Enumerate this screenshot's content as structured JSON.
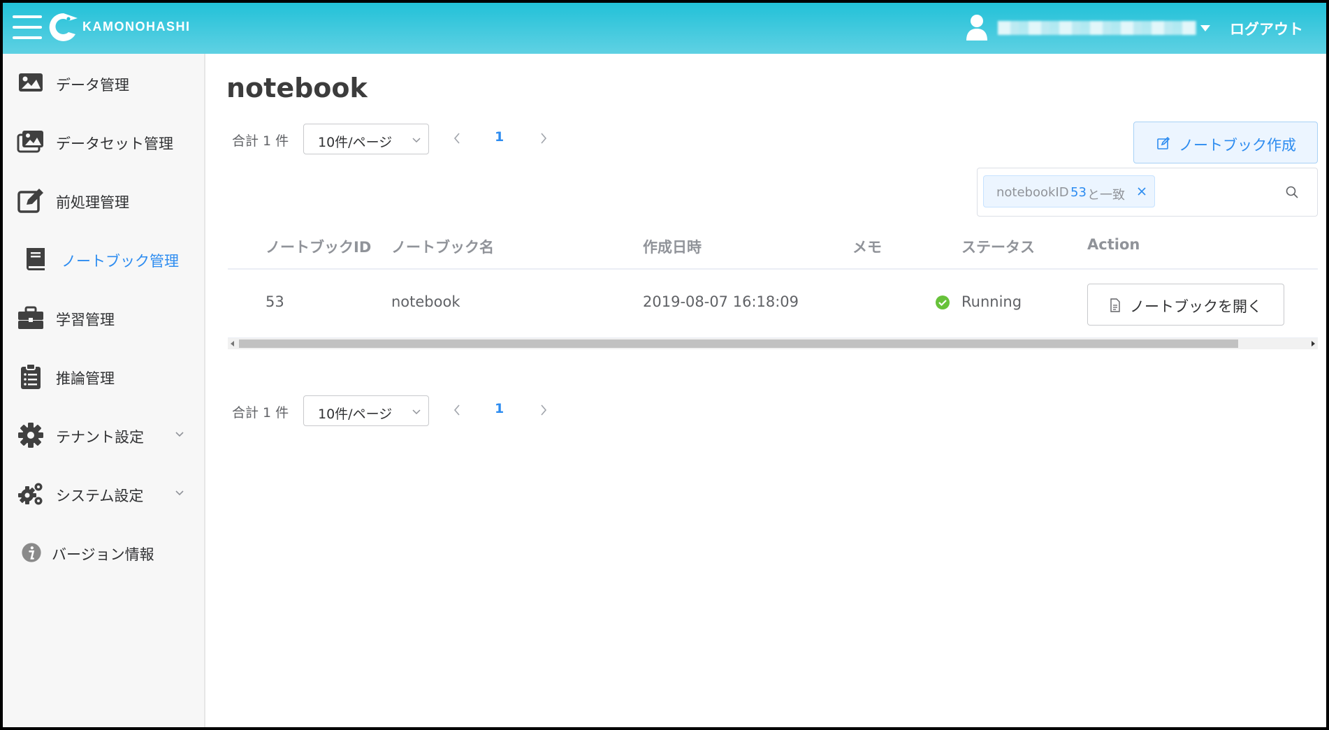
{
  "header": {
    "logo_text": "KAMONOHASHI",
    "logout_label": "ログアウト"
  },
  "sidebar": {
    "items": [
      {
        "label": "データ管理",
        "icon": "image-icon"
      },
      {
        "label": "データセット管理",
        "icon": "images-icon"
      },
      {
        "label": "前処理管理",
        "icon": "edit-icon"
      },
      {
        "label": "ノートブック管理",
        "icon": "book-icon"
      },
      {
        "label": "学習管理",
        "icon": "briefcase-icon"
      },
      {
        "label": "推論管理",
        "icon": "clipboard-icon"
      },
      {
        "label": "テナント設定",
        "icon": "gear-icon"
      },
      {
        "label": "システム設定",
        "icon": "gears-icon"
      },
      {
        "label": "バージョン情報",
        "icon": "info-icon"
      }
    ]
  },
  "main": {
    "title": "notebook",
    "create_button_label": "ノートブック作成",
    "pagination_top": {
      "total": "合計 1 件",
      "page_size": "10件/ページ",
      "current_page": "1"
    },
    "pagination_bottom": {
      "total": "合計 1 件",
      "page_size": "10件/ページ",
      "current_page": "1"
    },
    "filter": {
      "prefix": "notebookID",
      "value": "53",
      "suffix": "と一致"
    },
    "table": {
      "columns": [
        "ノートブックID",
        "ノートブック名",
        "作成日時",
        "メモ",
        "ステータス",
        "Action"
      ],
      "rows": [
        {
          "id": "53",
          "name": "notebook",
          "created_at": "2019-08-07 16:18:09",
          "memo": "",
          "status": "Running",
          "action_label": "ノートブックを開く"
        }
      ]
    }
  },
  "colors": {
    "header": "#22c1d8",
    "accent": "#2d8cf0",
    "status_running": "#67c23a"
  }
}
